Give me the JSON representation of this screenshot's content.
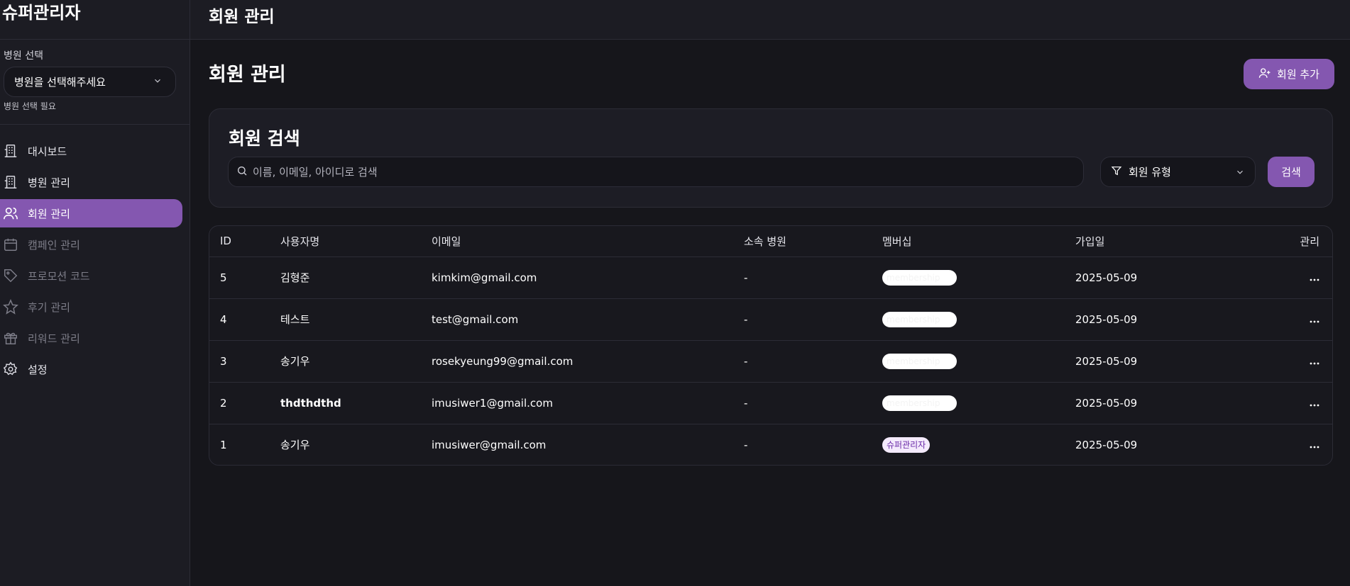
{
  "app": {
    "brand": "슈퍼관리자",
    "top_title": "회원 관리"
  },
  "sidebar": {
    "hospital_label": "병원 선택",
    "hospital_select_value": "병원을 선택해주세요",
    "hospital_hint": "병원 선택 필요",
    "items": [
      {
        "label": "대시보드",
        "icon": "building-icon"
      },
      {
        "label": "병원 관리",
        "icon": "building-icon"
      },
      {
        "label": "회원 관리",
        "icon": "users-icon"
      },
      {
        "label": "캠페인 관리",
        "icon": "calendar-icon"
      },
      {
        "label": "프로모션 코드",
        "icon": "tag-icon"
      },
      {
        "label": "후기 관리",
        "icon": "star-icon"
      },
      {
        "label": "리워드 관리",
        "icon": "gift-icon"
      },
      {
        "label": "설정",
        "icon": "gear-icon"
      }
    ]
  },
  "main": {
    "page_title": "회원 관리",
    "add_button": "회원 추가",
    "search": {
      "title": "회원 검색",
      "placeholder": "이름, 이메일, 아이디로 검색",
      "type_filter": "회원 유형",
      "button": "검색"
    },
    "table": {
      "headers": [
        "ID",
        "사용자명",
        "이메일",
        "소속 병원",
        "멤버십",
        "가입일",
        "관리"
      ],
      "rows": [
        {
          "id": "5",
          "name": "김형준",
          "email": "kimkim@gmail.com",
          "hospital": "-",
          "membership": "membership",
          "joined": "2025-05-09"
        },
        {
          "id": "4",
          "name": "테스트",
          "email": "test@gmail.com",
          "hospital": "-",
          "membership": "membership",
          "joined": "2025-05-09"
        },
        {
          "id": "3",
          "name": "송기우",
          "email": "rosekyeung99@gmail.com",
          "hospital": "-",
          "membership": "membership",
          "joined": "2025-05-09"
        },
        {
          "id": "2",
          "name": "thdthdthd",
          "email": "imusiwer1@gmail.com",
          "hospital": "-",
          "membership": "membership",
          "joined": "2025-05-09"
        },
        {
          "id": "1",
          "name": "송기우",
          "email": "imusiwer@gmail.com",
          "hospital": "-",
          "membership": "슈퍼관리자",
          "joined": "2025-05-09"
        }
      ]
    }
  },
  "colors": {
    "accent": "#8457b0",
    "background": "#16161b",
    "panel": "#1d1d25",
    "badge_super_text": "#6a2aa8"
  }
}
